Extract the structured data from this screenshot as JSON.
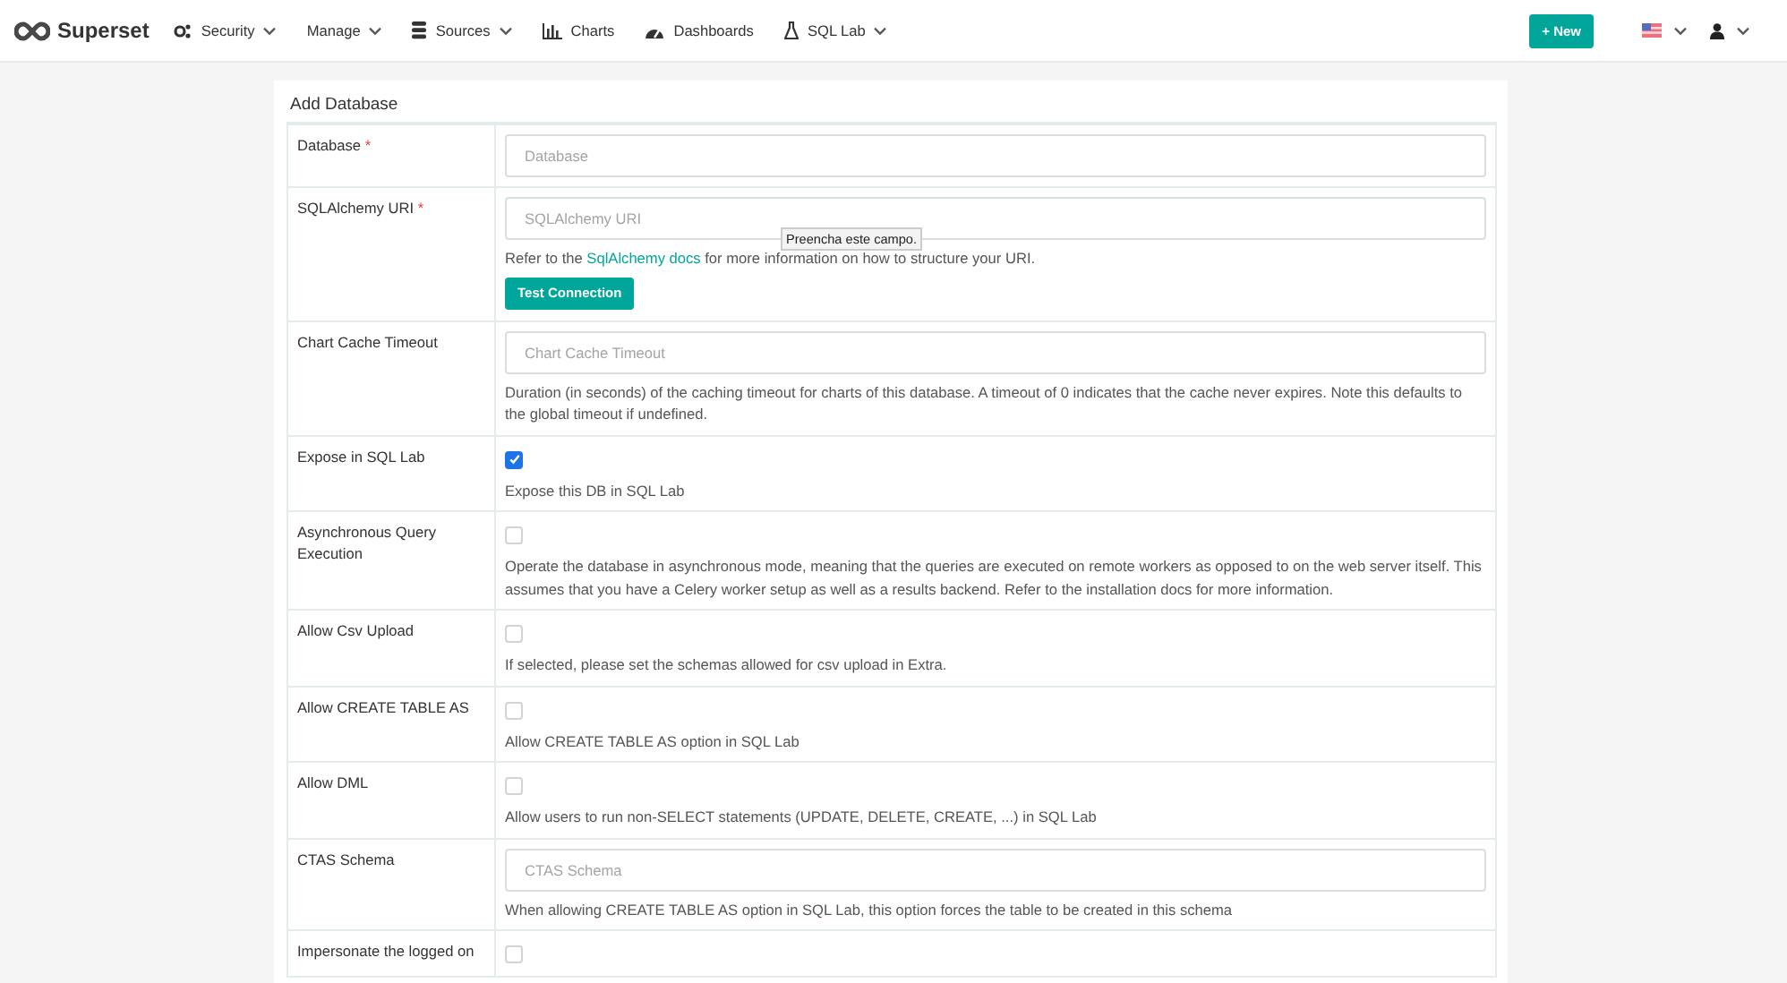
{
  "navbar": {
    "brand": "Superset",
    "menu": [
      {
        "label": "Security",
        "dropdown": true
      },
      {
        "label": "Manage",
        "dropdown": true
      },
      {
        "label": "Sources",
        "dropdown": true
      },
      {
        "label": "Charts",
        "dropdown": false
      },
      {
        "label": "Dashboards",
        "dropdown": false
      },
      {
        "label": "SQL Lab",
        "dropdown": true
      }
    ],
    "new_button": "+ New"
  },
  "form": {
    "title": "Add Database",
    "tooltip": "Preencha este campo.",
    "rows": [
      {
        "kind": "text",
        "label": "Database",
        "required_mark": "*",
        "placeholder": "Database"
      },
      {
        "kind": "text",
        "label": "SQLAlchemy URI",
        "required_mark": "*",
        "placeholder": "SQLAlchemy URI",
        "help_before": "Refer to the ",
        "help_link": "SqlAlchemy docs",
        "help_after": " for more information on how to structure your URI.",
        "button": "Test Connection"
      },
      {
        "kind": "text",
        "label": "Chart Cache Timeout",
        "placeholder": "Chart Cache Timeout",
        "help_before": "Duration (in seconds) of the caching timeout for charts of this database. A timeout of 0 indicates that the cache never expires. Note this defaults to the global timeout if undefined."
      },
      {
        "kind": "checkbox",
        "label": "Expose in SQL Lab",
        "checked": true,
        "help_before": "Expose this DB in SQL Lab"
      },
      {
        "kind": "checkbox",
        "label": "Asynchronous Query Execution",
        "checked": false,
        "help_before": "Operate the database in asynchronous mode, meaning that the queries are executed on remote workers as opposed to on the web server itself. This assumes that you have a Celery worker setup as well as a results backend. Refer to the installation docs for more information."
      },
      {
        "kind": "checkbox",
        "label": "Allow Csv Upload",
        "checked": false,
        "help_before": "If selected, please set the schemas allowed for csv upload in Extra."
      },
      {
        "kind": "checkbox",
        "label": "Allow CREATE TABLE AS",
        "checked": false,
        "help_before": "Allow CREATE TABLE AS option in SQL Lab"
      },
      {
        "kind": "checkbox",
        "label": "Allow DML",
        "checked": false,
        "help_before": "Allow users to run non-SELECT statements (UPDATE, DELETE, CREATE, ...) in SQL Lab"
      },
      {
        "kind": "text",
        "label": "CTAS Schema",
        "placeholder": "CTAS Schema",
        "help_before": "When allowing CREATE TABLE AS option in SQL Lab, this option forces the table to be created in this schema"
      },
      {
        "kind": "checkbox",
        "label": "Impersonate the logged on",
        "checked": false
      }
    ]
  }
}
